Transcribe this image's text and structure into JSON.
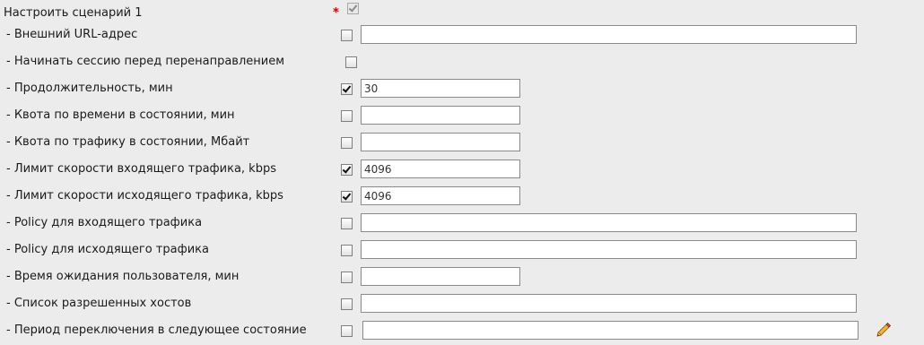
{
  "root": {
    "label": "Настроить сценарий 1",
    "required_mark": "*",
    "checked": true
  },
  "rows": [
    {
      "label": "- Внешний URL-адрес",
      "checked": false,
      "value": ""
    },
    {
      "label": "- Начинать сессию перед перенаправлением",
      "checked": false
    },
    {
      "label": "- Продолжительность, мин",
      "checked": true,
      "value": "30"
    },
    {
      "label": "- Квота по времени в состоянии, мин",
      "checked": false,
      "value": ""
    },
    {
      "label": "- Квота по трафику в состоянии, Мбайт",
      "checked": false,
      "value": ""
    },
    {
      "label": "- Лимит скорости входящего трафика, kbps",
      "checked": true,
      "value": "4096"
    },
    {
      "label": "- Лимит скорости исходящего трафика, kbps",
      "checked": true,
      "value": "4096"
    },
    {
      "label": "- Policy для входящего трафика",
      "checked": false,
      "value": ""
    },
    {
      "label": "- Policy для исходящего трафика",
      "checked": false,
      "value": ""
    },
    {
      "label": "- Время ожидания пользователя, мин",
      "checked": false,
      "value": ""
    },
    {
      "label": "- Список разрешенных хостов",
      "checked": false,
      "value": ""
    },
    {
      "label": "- Период переключения в следующее состояние",
      "checked": false,
      "value": ""
    }
  ],
  "icons": {
    "edit": "pencil-icon"
  }
}
